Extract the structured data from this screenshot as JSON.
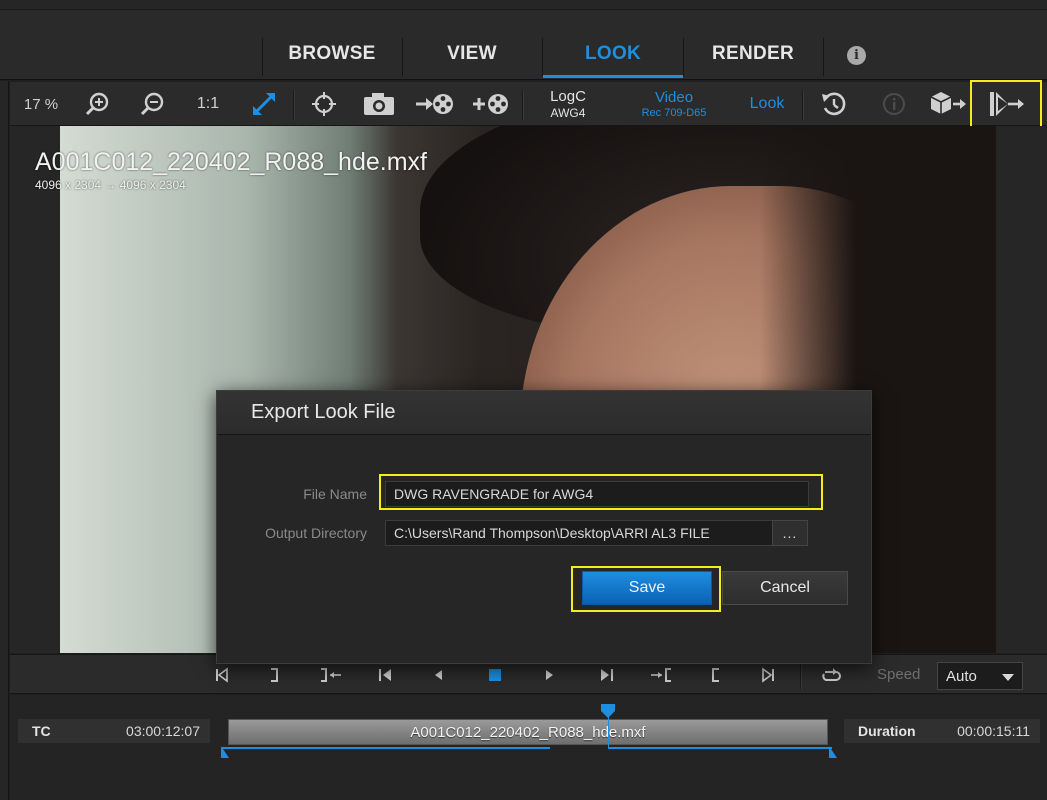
{
  "tabs": [
    {
      "label": "BROWSE",
      "active": false
    },
    {
      "label": "VIEW",
      "active": false
    },
    {
      "label": "LOOK",
      "active": true
    },
    {
      "label": "RENDER",
      "active": false
    }
  ],
  "info_icon_glyph": "i",
  "toolbar": {
    "zoom_percent": "17 %",
    "ratio_label": "1:1",
    "logc": {
      "line1": "LogC",
      "line2": "AWG4"
    },
    "video": {
      "line1": "Video",
      "line2": "Rec 709-D65"
    },
    "look_label": "Look",
    "icons": [
      "zoom-in-icon",
      "zoom-out-icon",
      "fit-expand-icon",
      "crosshair-icon",
      "camera-icon",
      "import-reel-icon",
      "add-reel-icon",
      "history-icon",
      "info-icon",
      "export-cube-icon",
      "export-look-icon"
    ]
  },
  "viewer": {
    "clip_name": "A001C012_220402_R088_hde.mxf",
    "resolution": "4096 x 2304  → 4096 x 2304"
  },
  "dialog": {
    "title": "Export Look File",
    "file_name_label": "File Name",
    "file_name_value": "DWG RAVENGRADE for AWG4",
    "output_dir_label": "Output Directory",
    "output_dir_value": "C:\\Users\\Rand Thompson\\Desktop\\ARRI AL3 FILE",
    "browse_label": "...",
    "save_label": "Save",
    "cancel_label": "Cancel"
  },
  "transport": {
    "speed_label": "Speed",
    "speed_value": "Auto"
  },
  "timeline": {
    "tc_label": "TC",
    "tc_value": "03:00:12:07",
    "clip_name": "A001C012_220402_R088_hde.mxf",
    "duration_label": "Duration",
    "duration_value": "00:00:15:11"
  },
  "colors": {
    "accent": "#1e8fe0",
    "highlight": "#f4ee18",
    "background": "#1f1f1f"
  }
}
